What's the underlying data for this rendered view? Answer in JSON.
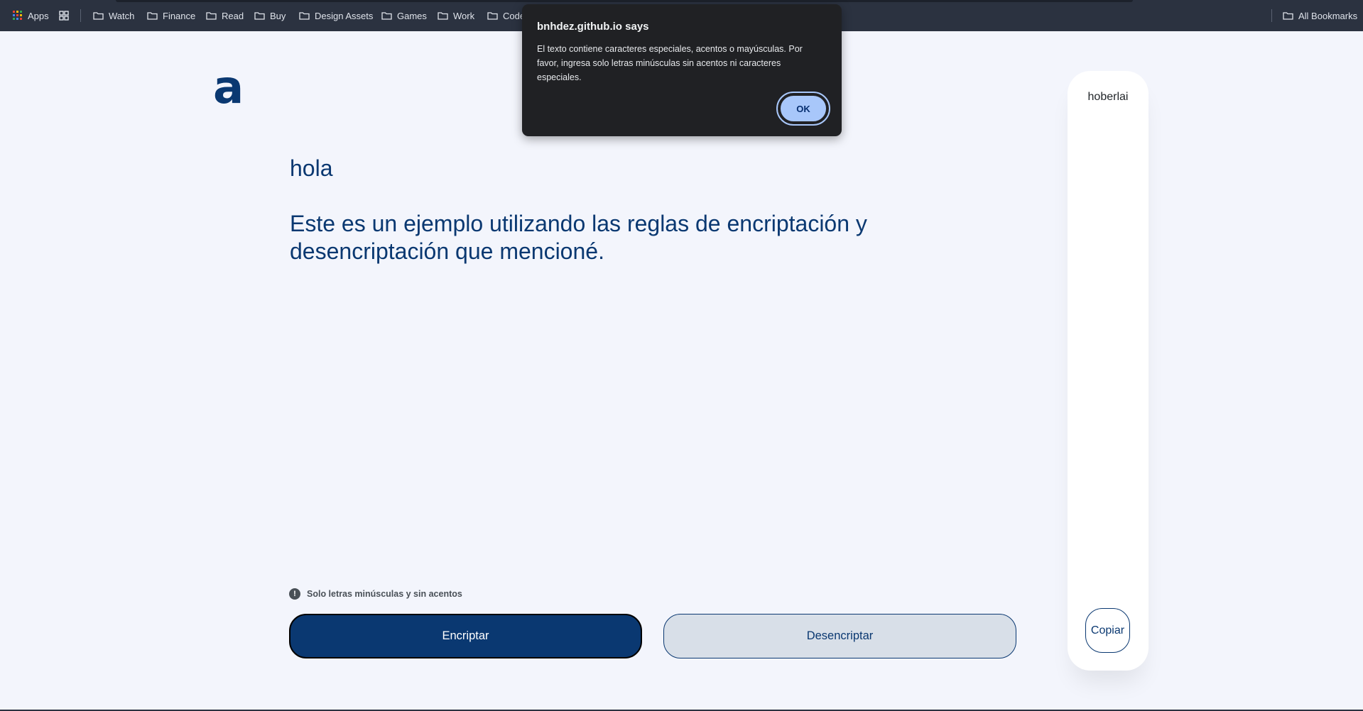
{
  "bookmarks": {
    "apps_label": "Apps",
    "items": [
      "Watch",
      "Finance",
      "Read",
      "Buy",
      "Design Assets",
      "Games",
      "Work",
      "Code"
    ],
    "all_bookmarks": "All Bookmarks"
  },
  "page": {
    "logo": "a",
    "input_text": "hola\n\nEste es un ejemplo utilizando las reglas de encriptación y\ndesencriptación que mencioné.",
    "hint": "Solo letras minúsculas y sin acentos",
    "hint_icon_glyph": "!",
    "encrypt_label": "Encriptar",
    "decrypt_label": "Desencriptar",
    "output_text": "hoberlai",
    "copy_label": "Copiar"
  },
  "dialog": {
    "title": "bnhdez.github.io says",
    "message": "El texto contiene caracteres especiales, acentos o mayúsculas. Por favor, ingresa solo letras minúsculas sin acentos ni caracteres especiales.",
    "ok_label": "OK"
  },
  "colors": {
    "accent": "#0a3871",
    "background": "#f3f5fc",
    "toolbar": "#2b3240",
    "dialog_bg": "#202124",
    "dialog_button": "#a8c7fa"
  }
}
